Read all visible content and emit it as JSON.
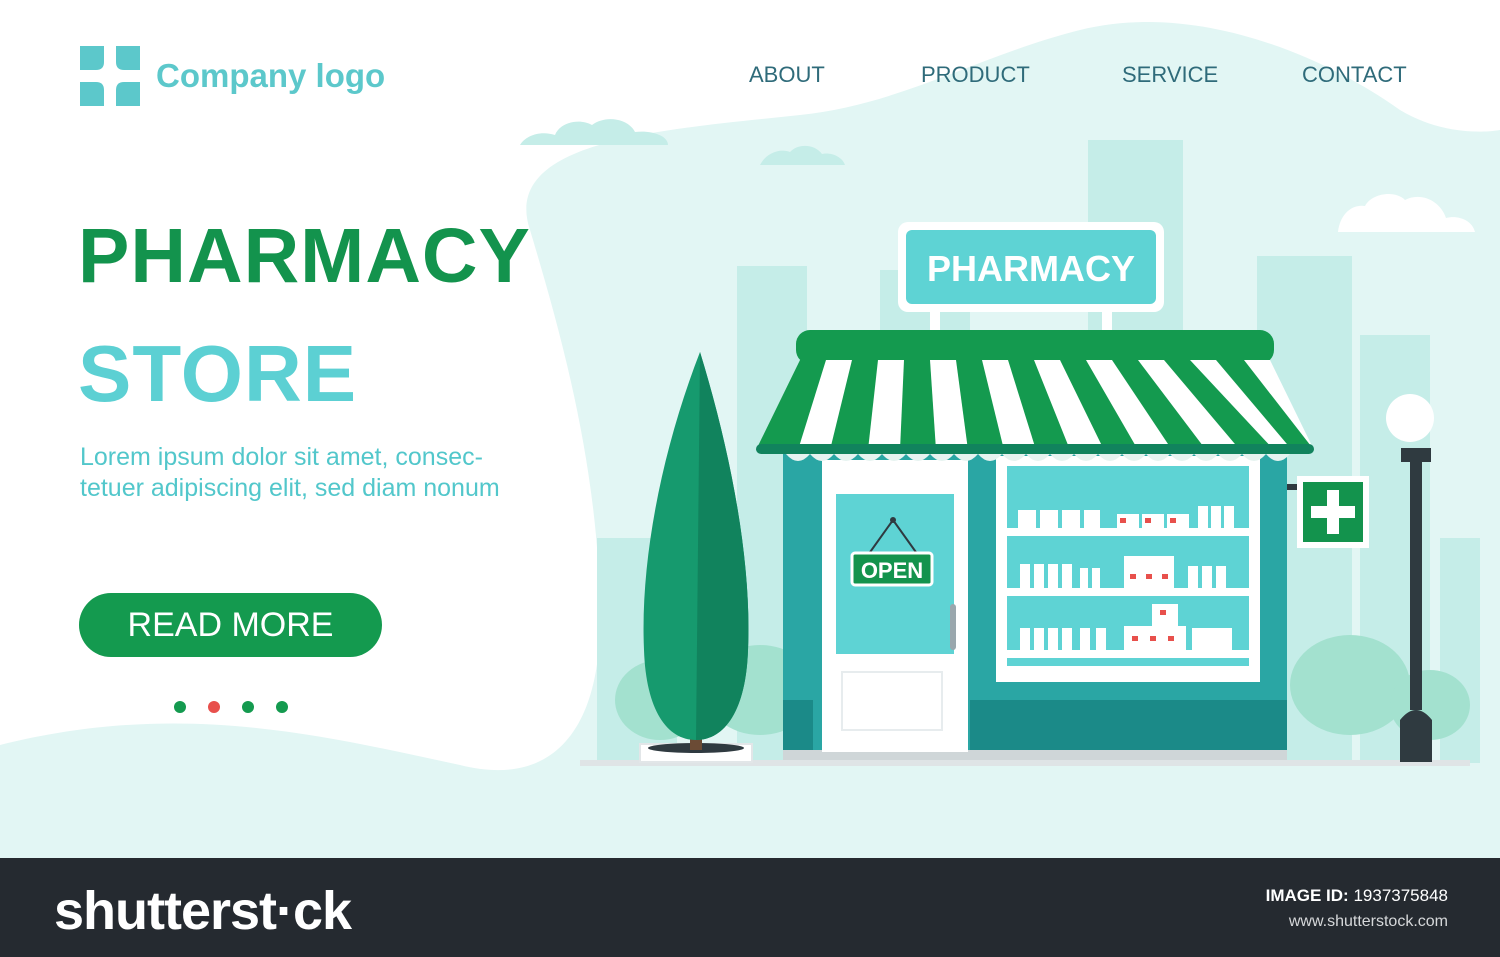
{
  "header": {
    "logo_text": "Company logo",
    "nav": [
      "ABOUT",
      "PRODUCT",
      "SERVICE",
      "CONTACT"
    ]
  },
  "hero": {
    "title": "PHARMACY",
    "subtitle": "STORE",
    "description": [
      "Lorem ipsum dolor sit amet, consec-",
      "tetuer adipiscing elit, sed diam nonum"
    ],
    "cta_label": "READ MORE",
    "carousel_dots": 4,
    "active_dot": 2
  },
  "illustration": {
    "shop_sign": "PHARMACY",
    "door_sign": "OPEN",
    "cross_sign_icon": "pharmacy-cross-icon"
  },
  "watermark": {
    "brand": "shutterstock",
    "brand_display": "shutterst·ck",
    "image_id_label": "IMAGE ID:",
    "image_id": "1937375848",
    "url": "www.shutterstock.com"
  },
  "colors": {
    "primary_green": "#149a4f",
    "accent_teal": "#5cc8cb",
    "nav_text": "#2f6b7a",
    "footer_bg": "#252a30",
    "active_dot": "#e8504c"
  }
}
